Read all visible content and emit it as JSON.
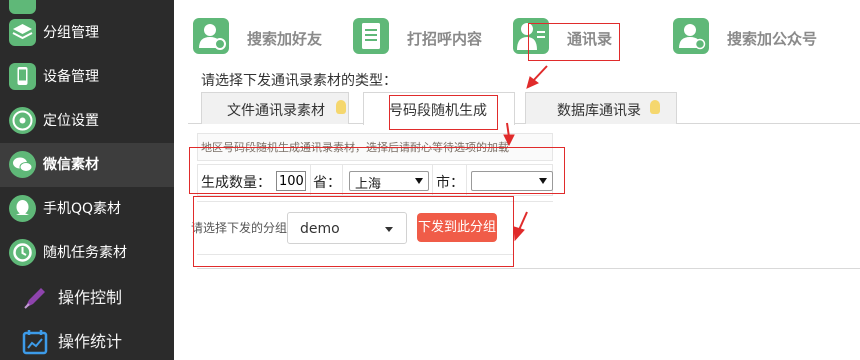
{
  "sidebar": {
    "items": [
      {
        "label": "分组管理",
        "icon": "layers-icon"
      },
      {
        "label": "设备管理",
        "icon": "phone-icon"
      },
      {
        "label": "定位设置",
        "icon": "location-icon"
      },
      {
        "label": "微信素材",
        "icon": "wechat-icon",
        "active": true
      },
      {
        "label": "手机QQ素材",
        "icon": "qq-icon"
      },
      {
        "label": "随机任务素材",
        "icon": "random-task-icon"
      }
    ],
    "sections": [
      {
        "label": "操作控制",
        "icon": "pen-icon"
      },
      {
        "label": "操作统计",
        "icon": "calendar-chart-icon"
      }
    ]
  },
  "functions": [
    {
      "label": "搜索加好友",
      "icon": "user-search-icon"
    },
    {
      "label": "打招呼内容",
      "icon": "document-icon"
    },
    {
      "label": "通讯录",
      "icon": "contacts-icon"
    },
    {
      "label": "搜索加公众号",
      "icon": "user-check-icon"
    }
  ],
  "prompt": "请选择下发通讯录素材的类型：",
  "tabs": [
    {
      "label": "文件通讯录素材"
    },
    {
      "label": "号码段随机生成",
      "active": true
    },
    {
      "label": "数据库通讯录"
    }
  ],
  "info_text": "地区号码段随机生成通讯录素材，选择后请耐心等待选项的加载",
  "form": {
    "count_label": "生成数量：",
    "count_value": "100",
    "province_label": "省：",
    "province_value": "上海",
    "city_label": "市：",
    "city_value": ""
  },
  "send": {
    "label": "请选择下发的分组",
    "group_value": "demo",
    "button_label": "下发到此分组"
  },
  "colors": {
    "sidebar_bg": "#2b2b2b",
    "accent_green": "#5fb878",
    "send_button": "#f05c48",
    "annotation_red": "#e02b2b"
  }
}
